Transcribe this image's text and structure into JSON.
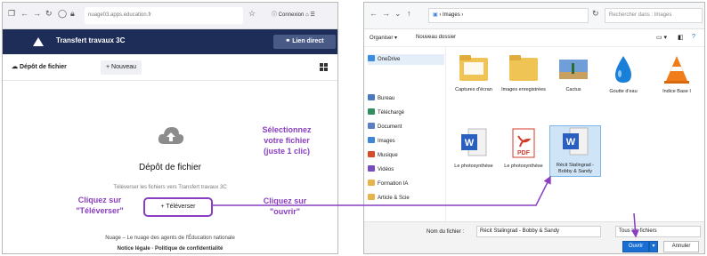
{
  "browser": {
    "url": "nuage03.apps.education.fr",
    "url_domain": "education.fr",
    "login_label": "Connexion"
  },
  "app": {
    "title": "Transfert travaux 3C",
    "direct_link_label": "Lien direct",
    "depot_tab_label": "Dépôt de fichier",
    "new_button_label": "+ Nouveau",
    "empty_title": "Dépôt de fichier",
    "empty_subtitle": "Téléverser les fichiers vers Transfert travaux 3C",
    "upload_button_label": "+ Téléverser",
    "footer_line1": "Nuage – Le nuage des agents de l'Éducation nationale",
    "footer_line2": "Notice légale · Politique de confidentialité"
  },
  "callouts": {
    "upload": [
      "Cliquez sur",
      "\"Téléverser\""
    ],
    "select": [
      "Sélectionnez",
      "votre fichier",
      "(juste 1 clic)"
    ],
    "open": [
      "Cliquez sur",
      "\"ouvrir\""
    ]
  },
  "explorer": {
    "path": "Images",
    "search_placeholder": "Rechercher dans : Images",
    "organize_label": "Organiser ▾",
    "new_folder_label": "Nouveau dossier",
    "nav_items": [
      {
        "label": "OneDrive",
        "color": "#3b8de0"
      },
      {
        "label": "Bureau",
        "color": "#4a78c0"
      },
      {
        "label": "Téléchargé",
        "color": "#2f8f5f"
      },
      {
        "label": "Document",
        "color": "#5a7fc4"
      },
      {
        "label": "Images",
        "color": "#3d86d8"
      },
      {
        "label": "Musique",
        "color": "#d84b2a"
      },
      {
        "label": "Vidéos",
        "color": "#7a4cc2"
      },
      {
        "label": "Formation IA",
        "color": "#e8b44a"
      },
      {
        "label": "Article & Scie",
        "color": "#e8b44a"
      }
    ],
    "files": [
      {
        "label": "Captures d'écran",
        "kind": "folder"
      },
      {
        "label": "Images enregistrées",
        "kind": "folder"
      },
      {
        "label": "Cactus",
        "kind": "photo"
      },
      {
        "label": "Goutte d'eau",
        "kind": "drop"
      },
      {
        "label": "Indice Base I",
        "kind": "cone"
      },
      {
        "label": "Le photosynthèse",
        "kind": "word"
      },
      {
        "label": "Le photosynthèse",
        "kind": "pdf"
      },
      {
        "label": "Récit Stalingrad - Bobby & Sandy",
        "kind": "word"
      }
    ],
    "filename_label": "Nom du fichier :",
    "filename_value": "Récit Stalingrad - Bobby & Sandy",
    "filter_value": "Tous les fichiers",
    "open_label": "Ouvrir",
    "cancel_label": "Annuler"
  },
  "colors": {
    "accent_purple": "#8a3ec2",
    "header_navy": "#1e2d58",
    "open_blue": "#1a6fd4"
  }
}
